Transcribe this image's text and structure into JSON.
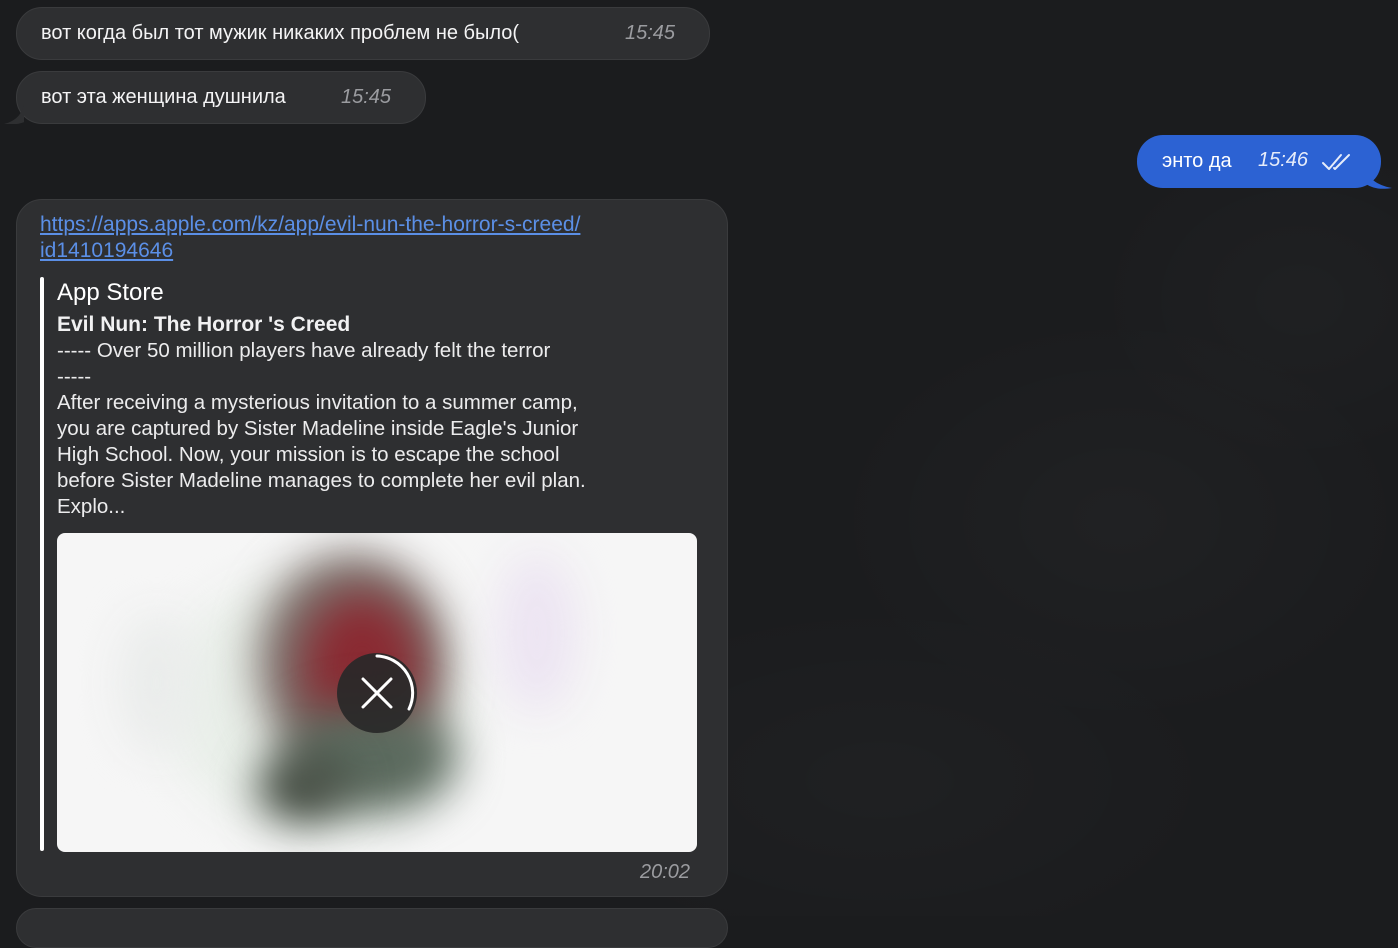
{
  "messages": {
    "m1": {
      "text": "вот когда был тот мужик никаких проблем не было(",
      "time": "15:45"
    },
    "m2": {
      "text": "вот эта женщина душнила",
      "time": "15:45"
    },
    "m3": {
      "text": "энто да",
      "time": "15:46",
      "status_icon": "double-check-icon"
    },
    "m4": {
      "link_line1": "https://apps.apple.com/kz/app/evil-nun-the-horror-s-creed/",
      "link_line2": "id1410194646",
      "preview": {
        "site": "App Store",
        "title": "Evil Nun: The Horror 's Creed",
        "desc_lines": [
          "----- Over 50 million players have already felt the terror",
          "-----",
          "After receiving a mysterious invitation to a summer camp,",
          "you are captured by Sister Madeline inside Eagle's Junior",
          "High School. Now, your mission is to escape the school",
          "before Sister Madeline manages to complete her evil plan.",
          "Explo..."
        ],
        "image_icon": "cancel-download-icon"
      },
      "time": "20:02"
    }
  },
  "colors": {
    "background": "#1b1c1e",
    "incoming_bubble": "#2e2f31",
    "outgoing_bubble": "#2c62d3",
    "link": "#5b8fe6"
  }
}
